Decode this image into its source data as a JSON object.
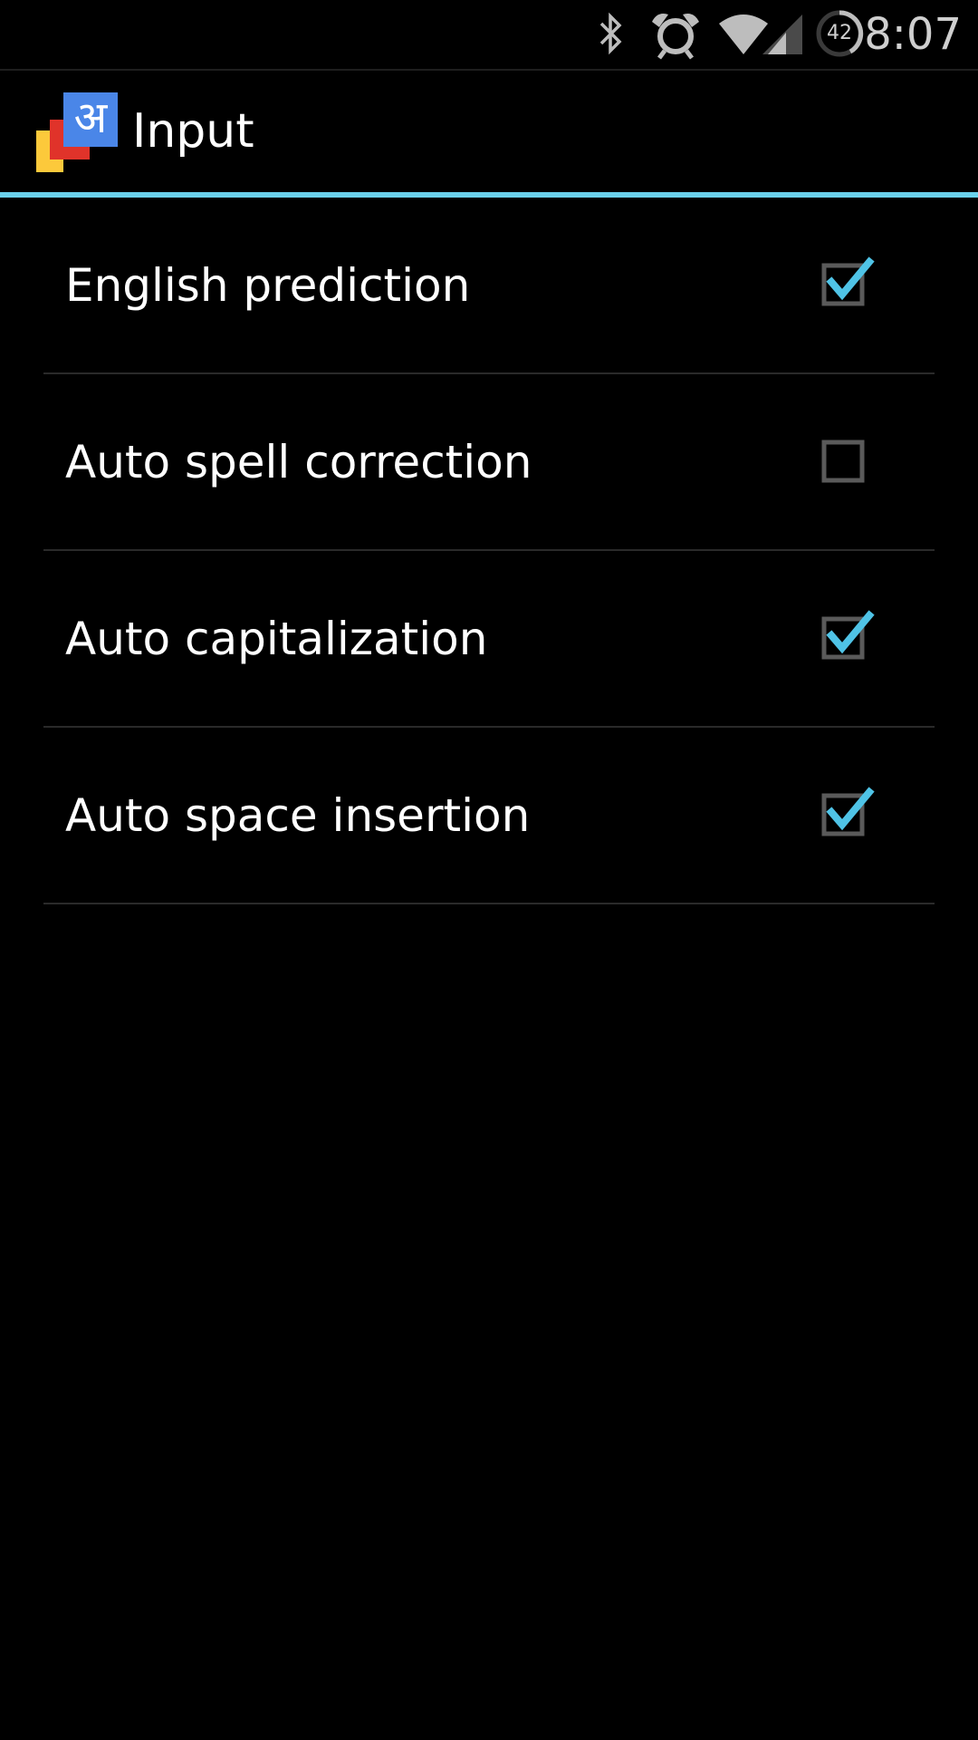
{
  "status_bar": {
    "time": "8:07",
    "battery_level": "42",
    "icons": [
      "bluetooth-icon",
      "alarm-icon",
      "wifi-icon",
      "signal-icon",
      "battery-icon"
    ]
  },
  "action_bar": {
    "title": "Input",
    "logo_glyph": "अ",
    "accent_color": "#6ad1ec"
  },
  "preferences": [
    {
      "label": "English prediction",
      "checked": true
    },
    {
      "label": "Auto spell correction",
      "checked": false
    },
    {
      "label": "Auto capitalization",
      "checked": true
    },
    {
      "label": "Auto space insertion",
      "checked": true
    }
  ],
  "colors": {
    "background": "#000000",
    "check_mark": "#4fc3e6",
    "checkbox_border": "#5a5a5a"
  }
}
